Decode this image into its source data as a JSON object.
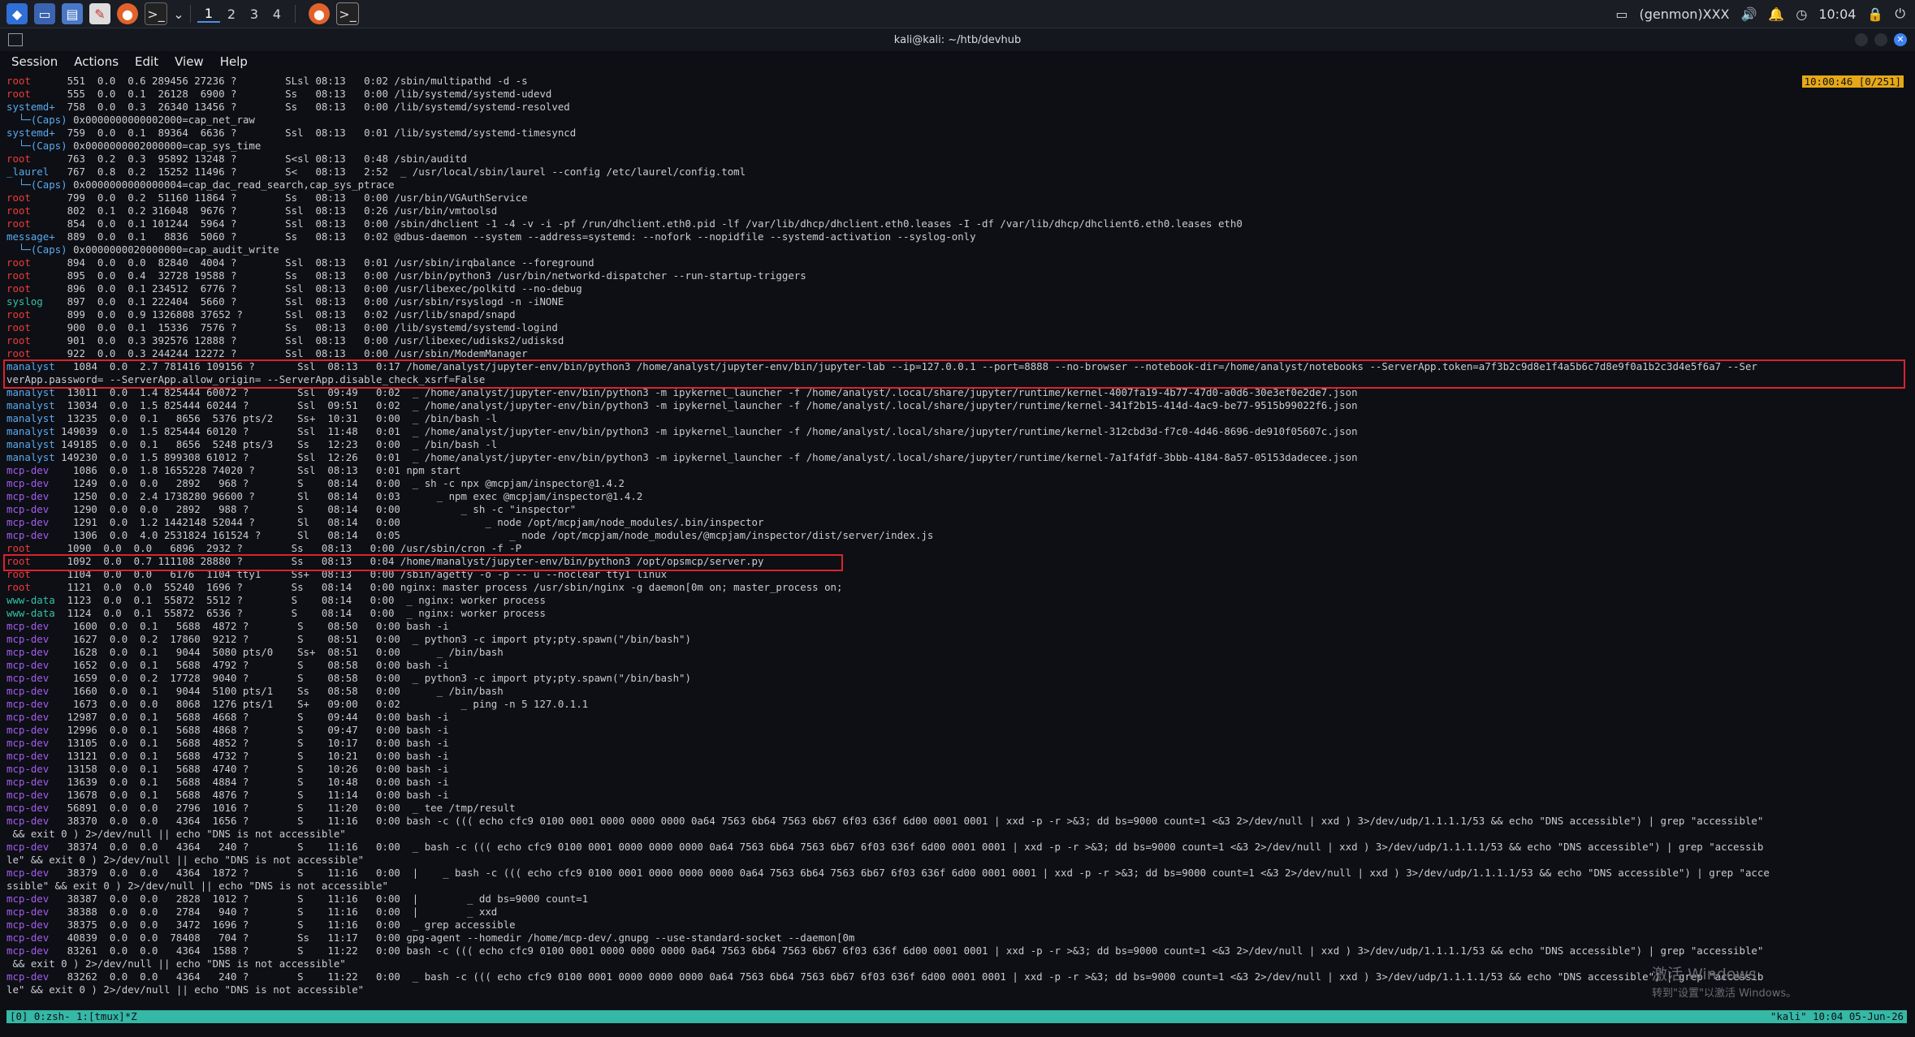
{
  "taskbar": {
    "workspaces": [
      "1",
      "2",
      "3",
      "4"
    ],
    "active_workspace": "1",
    "network_label": "(genmon)XXX",
    "clock": "10:04"
  },
  "window": {
    "title": "kali@kali: ~/htb/devhub"
  },
  "menubar": {
    "items": [
      "Session",
      "Actions",
      "Edit",
      "View",
      "Help"
    ]
  },
  "tmux_clock": "10:00:46 [0/251]",
  "status_bar": {
    "left": "[0] 0:zsh- 1:[tmux]*Z",
    "right": "\"kali\" 10:04 05-Jun-26"
  },
  "watermark": {
    "line1": "激活 Windows",
    "line2": "转到\"设置\"以激活 Windows。"
  },
  "colors": {
    "highlight_box": "#d9232e",
    "status_bar": "#35b8a6",
    "tmux_clock": "#e6a817"
  },
  "terminal_lines": [
    {
      "u": "root",
      "c": "u-root",
      "r": "      551  0.0  0.6 289456 27236 ?        SLsl 08:13   0:02 /sbin/multipathd -d -s"
    },
    {
      "u": "root",
      "c": "u-root",
      "r": "      555  0.0  0.1  26128  6900 ?        Ss   08:13   0:00 /lib/systemd/systemd-udevd"
    },
    {
      "u": "systemd+",
      "c": "u-systemd",
      "r": "  758  0.0  0.3  26340 13456 ?        Ss   08:13   0:00 /lib/systemd/systemd-resolved"
    },
    {
      "u": "  └─(Caps)",
      "c": "u-caps",
      "r": " 0x0000000000002000=cap_net_raw"
    },
    {
      "u": "systemd+",
      "c": "u-systemd",
      "r": "  759  0.0  0.1  89364  6636 ?        Ssl  08:13   0:01 /lib/systemd/systemd-timesyncd"
    },
    {
      "u": "  └─(Caps)",
      "c": "u-caps",
      "r": " 0x0000000002000000=cap_sys_time"
    },
    {
      "u": "root",
      "c": "u-root",
      "r": "      763  0.2  0.3  95892 13248 ?        S<sl 08:13   0:48 /sbin/auditd"
    },
    {
      "u": "_laurel",
      "c": "u-laurel",
      "r": "   767  0.8  0.2  15252 11496 ?        S<   08:13   2:52  _ /usr/local/sbin/laurel --config /etc/laurel/config.toml"
    },
    {
      "u": "  └─(Caps)",
      "c": "u-caps",
      "r": " 0x0000000000000004=cap_dac_read_search,cap_sys_ptrace"
    },
    {
      "u": "root",
      "c": "u-root",
      "r": "      799  0.0  0.2  51160 11864 ?        Ss   08:13   0:00 /usr/bin/VGAuthService"
    },
    {
      "u": "root",
      "c": "u-root",
      "r": "      802  0.1  0.2 316048  9676 ?        Ssl  08:13   0:26 /usr/bin/vmtoolsd"
    },
    {
      "u": "root",
      "c": "u-root",
      "r": "      854  0.0  0.1 101244  5964 ?        Ssl  08:13   0:00 /sbin/dhclient -1 -4 -v -i -pf /run/dhclient.eth0.pid -lf /var/lib/dhcp/dhclient.eth0.leases -I -df /var/lib/dhcp/dhclient6.eth0.leases eth0"
    },
    {
      "u": "message+",
      "c": "u-message",
      "r": "  889  0.0  0.1   8836  5060 ?        Ss   08:13   0:02 @dbus-daemon --system --address=systemd: --nofork --nopidfile --systemd-activation --syslog-only"
    },
    {
      "u": "  └─(Caps)",
      "c": "u-caps",
      "r": " 0x0000000020000000=cap_audit_write"
    },
    {
      "u": "root",
      "c": "u-root",
      "r": "      894  0.0  0.0  82840  4004 ?        Ssl  08:13   0:01 /usr/sbin/irqbalance --foreground"
    },
    {
      "u": "root",
      "c": "u-root",
      "r": "      895  0.0  0.4  32728 19588 ?        Ss   08:13   0:00 /usr/bin/python3 /usr/bin/networkd-dispatcher --run-startup-triggers"
    },
    {
      "u": "root",
      "c": "u-root",
      "r": "      896  0.0  0.1 234512  6776 ?        Ssl  08:13   0:00 /usr/libexec/polkitd --no-debug"
    },
    {
      "u": "syslog",
      "c": "u-syslog",
      "r": "    897  0.0  0.1 222404  5660 ?        Ssl  08:13   0:00 /usr/sbin/rsyslogd -n -iNONE"
    },
    {
      "u": "root",
      "c": "u-root",
      "r": "      899  0.0  0.9 1326808 37652 ?       Ssl  08:13   0:02 /usr/lib/snapd/snapd"
    },
    {
      "u": "root",
      "c": "u-root",
      "r": "      900  0.0  0.1  15336  7576 ?        Ss   08:13   0:00 /lib/systemd/systemd-logind"
    },
    {
      "u": "root",
      "c": "u-root",
      "r": "      901  0.0  0.3 392576 12888 ?        Ssl  08:13   0:00 /usr/libexec/udisks2/udisksd"
    },
    {
      "u": "root",
      "c": "u-root",
      "r": "      922  0.0  0.3 244244 12272 ?        Ssl  08:13   0:00 /usr/sbin/ModemManager"
    },
    {
      "u": "manalyst",
      "c": "u-analyst",
      "r": "   1084  0.0  2.7 781416 109156 ?       Ssl  08:13   0:17 /home/analyst/jupyter-env/bin/python3 /home/analyst/jupyter-env/bin/jupyter-lab --ip=127.0.0.1 --port=8888 --no-browser --notebook-dir=/home/analyst/notebooks --ServerApp.token=a7f3b2c9d8e1f4a5b6c7d8e9f0a1b2c3d4e5f6a7 --Ser"
    },
    {
      "u": "verApp.password= --ServerApp.allow_origin= --ServerApp.disable_check_xsrf=False",
      "c": "",
      "r": ""
    },
    {
      "u": "manalyst",
      "c": "u-analyst",
      "r": "  13011  0.0  1.4 825444 60072 ?        Ssl  09:49   0:02  _ /home/analyst/jupyter-env/bin/python3 -m ipykernel_launcher -f /home/analyst/.local/share/jupyter/runtime/kernel-4007fa19-4b77-47d0-a0d6-30e3ef0e2de7.json"
    },
    {
      "u": "manalyst",
      "c": "u-analyst",
      "r": "  13034  0.0  1.5 825444 60244 ?        Ssl  09:51   0:02  _ /home/analyst/jupyter-env/bin/python3 -m ipykernel_launcher -f /home/analyst/.local/share/jupyter/runtime/kernel-341f2b15-414d-4ac9-be77-9515b99022f6.json"
    },
    {
      "u": "manalyst",
      "c": "u-analyst",
      "r": "  13235  0.0  0.1   8656  5376 pts/2    Ss+  10:31   0:00  _ /bin/bash -l"
    },
    {
      "u": "manalyst",
      "c": "u-analyst",
      "r": " 149039  0.0  1.5 825444 60120 ?        Ssl  11:48   0:01  _ /home/analyst/jupyter-env/bin/python3 -m ipykernel_launcher -f /home/analyst/.local/share/jupyter/runtime/kernel-312cbd3d-f7c0-4d46-8696-de910f05607c.json"
    },
    {
      "u": "manalyst",
      "c": "u-analyst",
      "r": " 149185  0.0  0.1   8656  5248 pts/3    Ss   12:23   0:00  _ /bin/bash -l"
    },
    {
      "u": "manalyst",
      "c": "u-analyst",
      "r": " 149230  0.0  1.5 899308 61012 ?        Ssl  12:26   0:01  _ /home/analyst/jupyter-env/bin/python3 -m ipykernel_launcher -f /home/analyst/.local/share/jupyter/runtime/kernel-7a1f4fdf-3bbb-4184-8a57-05153dadecee.json"
    },
    {
      "u": "mcp-dev",
      "c": "u-mcp",
      "r": "    1086  0.0  1.8 1655228 74020 ?       Ssl  08:13   0:01 npm start"
    },
    {
      "u": "mcp-dev",
      "c": "u-mcp",
      "r": "    1249  0.0  0.0   2892   968 ?        S    08:14   0:00  _ sh -c npx @mcpjam/inspector@1.4.2"
    },
    {
      "u": "mcp-dev",
      "c": "u-mcp",
      "r": "    1250  0.0  2.4 1738280 96600 ?       Sl   08:14   0:03      _ npm exec @mcpjam/inspector@1.4.2"
    },
    {
      "u": "mcp-dev",
      "c": "u-mcp",
      "r": "    1290  0.0  0.0   2892   988 ?        S    08:14   0:00          _ sh -c \"inspector\""
    },
    {
      "u": "mcp-dev",
      "c": "u-mcp",
      "r": "    1291  0.0  1.2 1442148 52044 ?       Sl   08:14   0:00              _ node /opt/mcpjam/node_modules/.bin/inspector"
    },
    {
      "u": "mcp-dev",
      "c": "u-mcp",
      "r": "    1306  0.0  4.0 2531824 161524 ?      Sl   08:14   0:05                  _ node /opt/mcpjam/node_modules/@mcpjam/inspector/dist/server/index.js"
    },
    {
      "u": "root",
      "c": "u-root",
      "r": "      1090  0.0  0.0   6896  2932 ?        Ss   08:13   0:00 /usr/sbin/cron -f -P"
    },
    {
      "u": "root",
      "c": "u-root",
      "r": "      1092  0.0  0.7 111108 28880 ?        Ss   08:13   0:04 /home/manalyst/jupyter-env/bin/python3 /opt/opsmcp/server.py"
    },
    {
      "u": "root",
      "c": "u-root",
      "r": "      1104  0.0  0.0   6176  1104 tty1     Ss+  08:13   0:00 /sbin/agetty -o -p -- u --noclear tty1 linux"
    },
    {
      "u": "root",
      "c": "u-root",
      "r": "      1121  0.0  0.0  55240  1696 ?        Ss   08:14   0:00 nginx: master process /usr/sbin/nginx -g daemon[0m on; master_process on;"
    },
    {
      "u": "www-data",
      "c": "u-www",
      "r": "  1123  0.0  0.1  55872  5512 ?        S    08:14   0:00  _ nginx: worker process"
    },
    {
      "u": "www-data",
      "c": "u-www",
      "r": "  1124  0.0  0.1  55872  6536 ?        S    08:14   0:00  _ nginx: worker process"
    },
    {
      "u": "mcp-dev",
      "c": "u-mcp",
      "r": "    1600  0.0  0.1   5688  4872 ?        S    08:50   0:00 bash -i"
    },
    {
      "u": "mcp-dev",
      "c": "u-mcp",
      "r": "    1627  0.0  0.2  17860  9212 ?        S    08:51   0:00  _ python3 -c import pty;pty.spawn(\"/bin/bash\")"
    },
    {
      "u": "mcp-dev",
      "c": "u-mcp",
      "r": "    1628  0.0  0.1   9044  5080 pts/0    Ss+  08:51   0:00      _ /bin/bash"
    },
    {
      "u": "mcp-dev",
      "c": "u-mcp",
      "r": "    1652  0.0  0.1   5688  4792 ?        S    08:58   0:00 bash -i"
    },
    {
      "u": "mcp-dev",
      "c": "u-mcp",
      "r": "    1659  0.0  0.2  17728  9040 ?        S    08:58   0:00  _ python3 -c import pty;pty.spawn(\"/bin/bash\")"
    },
    {
      "u": "mcp-dev",
      "c": "u-mcp",
      "r": "    1660  0.0  0.1   9044  5100 pts/1    Ss   08:58   0:00      _ /bin/bash"
    },
    {
      "u": "mcp-dev",
      "c": "u-mcp",
      "r": "    1673  0.0  0.0   8068  1276 pts/1    S+   09:00   0:02          _ ping -n 5 127.0.1.1"
    },
    {
      "u": "mcp-dev",
      "c": "u-mcp",
      "r": "   12987  0.0  0.1   5688  4668 ?        S    09:44   0:00 bash -i"
    },
    {
      "u": "mcp-dev",
      "c": "u-mcp",
      "r": "   12996  0.0  0.1   5688  4868 ?        S    09:47   0:00 bash -i"
    },
    {
      "u": "mcp-dev",
      "c": "u-mcp",
      "r": "   13105  0.0  0.1   5688  4852 ?        S    10:17   0:00 bash -i"
    },
    {
      "u": "mcp-dev",
      "c": "u-mcp",
      "r": "   13121  0.0  0.1   5688  4732 ?        S    10:21   0:00 bash -i"
    },
    {
      "u": "mcp-dev",
      "c": "u-mcp",
      "r": "   13158  0.0  0.1   5688  4740 ?        S    10:26   0:00 bash -i"
    },
    {
      "u": "mcp-dev",
      "c": "u-mcp",
      "r": "   13639  0.0  0.1   5688  4884 ?        S    10:48   0:00 bash -i"
    },
    {
      "u": "mcp-dev",
      "c": "u-mcp",
      "r": "   13678  0.0  0.1   5688  4876 ?        S    11:14   0:00 bash -i"
    },
    {
      "u": "mcp-dev",
      "c": "u-mcp",
      "r": "   56891  0.0  0.0   2796  1016 ?        S    11:20   0:00  _ tee /tmp/result"
    },
    {
      "u": "mcp-dev",
      "c": "u-mcp",
      "r": "   38370  0.0  0.0   4364  1656 ?        S    11:16   0:00 bash -c ((( echo cfc9 0100 0001 0000 0000 0000 0a64 7563 6b64 7563 6b67 6f03 636f 6d00 0001 0001 | xxd -p -r >&3; dd bs=9000 count=1 <&3 2>/dev/null | xxd ) 3>/dev/udp/1.1.1.1/53 && echo \"DNS accessible\") | grep \"accessible\""
    },
    {
      "u": " && exit 0 ) 2>/dev/null || echo \"DNS is not accessible\"",
      "c": "",
      "r": ""
    },
    {
      "u": "mcp-dev",
      "c": "u-mcp",
      "r": "   38374  0.0  0.0   4364   240 ?        S    11:16   0:00  _ bash -c ((( echo cfc9 0100 0001 0000 0000 0000 0a64 7563 6b64 7563 6b67 6f03 636f 6d00 0001 0001 | xxd -p -r >&3; dd bs=9000 count=1 <&3 2>/dev/null | xxd ) 3>/dev/udp/1.1.1.1/53 && echo \"DNS accessible\") | grep \"accessib"
    },
    {
      "u": "le\" && exit 0 ) 2>/dev/null || echo \"DNS is not accessible\"",
      "c": "",
      "r": ""
    },
    {
      "u": "mcp-dev",
      "c": "u-mcp",
      "r": "   38379  0.0  0.0   4364  1872 ?        S    11:16   0:00  |    _ bash -c ((( echo cfc9 0100 0001 0000 0000 0000 0a64 7563 6b64 7563 6b67 6f03 636f 6d00 0001 0001 | xxd -p -r >&3; dd bs=9000 count=1 <&3 2>/dev/null | xxd ) 3>/dev/udp/1.1.1.1/53 && echo \"DNS accessible\") | grep \"acce"
    },
    {
      "u": "ssible\" && exit 0 ) 2>/dev/null || echo \"DNS is not accessible\"",
      "c": "",
      "r": ""
    },
    {
      "u": "mcp-dev",
      "c": "u-mcp",
      "r": "   38387  0.0  0.0   2828  1012 ?        S    11:16   0:00  |        _ dd bs=9000 count=1"
    },
    {
      "u": "mcp-dev",
      "c": "u-mcp",
      "r": "   38388  0.0  0.0   2784   940 ?        S    11:16   0:00  |        _ xxd"
    },
    {
      "u": "mcp-dev",
      "c": "u-mcp",
      "r": "   38375  0.0  0.0   3472  1696 ?        S    11:16   0:00  _ grep accessible"
    },
    {
      "u": "mcp-dev",
      "c": "u-mcp",
      "r": "   40839  0.0  0.0  78408   704 ?        Ss   11:17   0:00 gpg-agent --homedir /home/mcp-dev/.gnupg --use-standard-socket --daemon[0m"
    },
    {
      "u": "mcp-dev",
      "c": "u-mcp",
      "r": "   83261  0.0  0.0   4364  1588 ?        S    11:22   0:00 bash -c ((( echo cfc9 0100 0001 0000 0000 0000 0a64 7563 6b64 7563 6b67 6f03 636f 6d00 0001 0001 | xxd -p -r >&3; dd bs=9000 count=1 <&3 2>/dev/null | xxd ) 3>/dev/udp/1.1.1.1/53 && echo \"DNS accessible\") | grep \"accessible\""
    },
    {
      "u": " && exit 0 ) 2>/dev/null || echo \"DNS is not accessible\"",
      "c": "",
      "r": ""
    },
    {
      "u": "mcp-dev",
      "c": "u-mcp",
      "r": "   83262  0.0  0.0   4364   240 ?        S    11:22   0:00  _ bash -c ((( echo cfc9 0100 0001 0000 0000 0000 0a64 7563 6b64 7563 6b67 6f03 636f 6d00 0001 0001 | xxd -p -r >&3; dd bs=9000 count=1 <&3 2>/dev/null | xxd ) 3>/dev/udp/1.1.1.1/53 && echo \"DNS accessible\") | grep \"accessib"
    },
    {
      "u": "le\" && exit 0 ) 2>/dev/null || echo \"DNS is not accessible\"",
      "c": "",
      "r": ""
    }
  ]
}
